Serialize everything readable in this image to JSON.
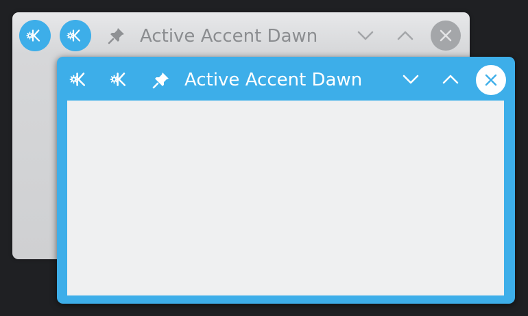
{
  "background_window": {
    "title": "Active Accent Dawn",
    "buttons": {
      "app_menu_icon": "kde-logo-icon",
      "on_all_desktops_icon": "kde-logo-icon",
      "keep_above_icon": "pin-icon",
      "minimize_icon": "chevron-down-icon",
      "maximize_icon": "chevron-up-icon",
      "close_icon": "close-icon"
    }
  },
  "foreground_window": {
    "title": "Active Accent Dawn",
    "buttons": {
      "app_menu_icon": "kde-logo-icon",
      "on_all_desktops_icon": "kde-logo-icon",
      "keep_above_icon": "pin-icon",
      "minimize_icon": "chevron-down-icon",
      "maximize_icon": "chevron-up-icon",
      "close_icon": "close-icon"
    }
  },
  "colors": {
    "accent": "#3daee9",
    "desktop": "#1f2023",
    "inactive_titlebar": "#e0e1e3",
    "inactive_button": "#a4a6a9",
    "client_area": "#eff0f1"
  }
}
